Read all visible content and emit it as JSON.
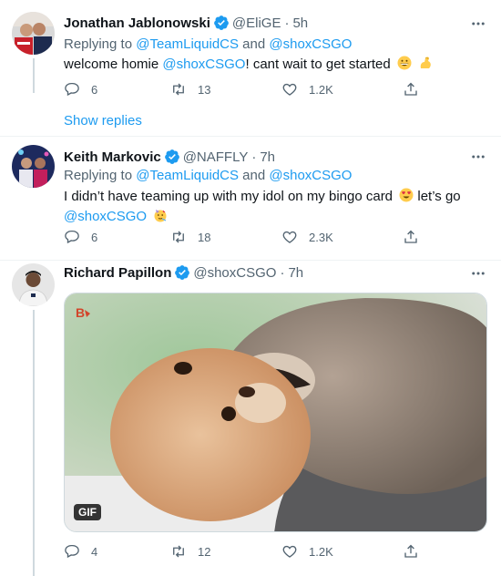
{
  "tweets": [
    {
      "name": "Jonathan Jablonowski",
      "handle": "@EliGE",
      "dot": "·",
      "time": "5h",
      "replying_prefix": "Replying to ",
      "replying_user1": "@TeamLiquidCS",
      "replying_and": " and ",
      "replying_user2": "@shoxCSGO",
      "text_before": "welcome homie ",
      "mention": "@shoxCSGO",
      "text_after": "! cant wait to get started",
      "replies": "6",
      "retweets": "13",
      "likes": "1.2K",
      "show_replies": "Show replies"
    },
    {
      "name": "Keith Markovic",
      "handle": "@NAFFLY",
      "dot": "·",
      "time": "7h",
      "replying_prefix": "Replying to ",
      "replying_user1": "@TeamLiquidCS",
      "replying_and": " and ",
      "replying_user2": "@shoxCSGO",
      "line1": "I didn’t have teaming up with my idol on my bingo card",
      "line1_after": " let’s go",
      "mention": "@shoxCSGO",
      "replies": "6",
      "retweets": "18",
      "likes": "2.3K"
    },
    {
      "name": "Richard Papillon",
      "handle": "@shoxCSGO",
      "dot": "·",
      "time": "7h",
      "gif_label": "GIF",
      "replies": "4",
      "retweets": "12",
      "likes": "1.2K"
    }
  ],
  "icons": {
    "reply": "reply-icon",
    "retweet": "retweet-icon",
    "like": "heart-icon",
    "share": "share-icon",
    "more": "more-icon",
    "verified": "verified-badge-icon"
  },
  "colors": {
    "accent": "#1d9bf0",
    "secondary_text": "#536471",
    "primary_text": "#0f1419"
  }
}
